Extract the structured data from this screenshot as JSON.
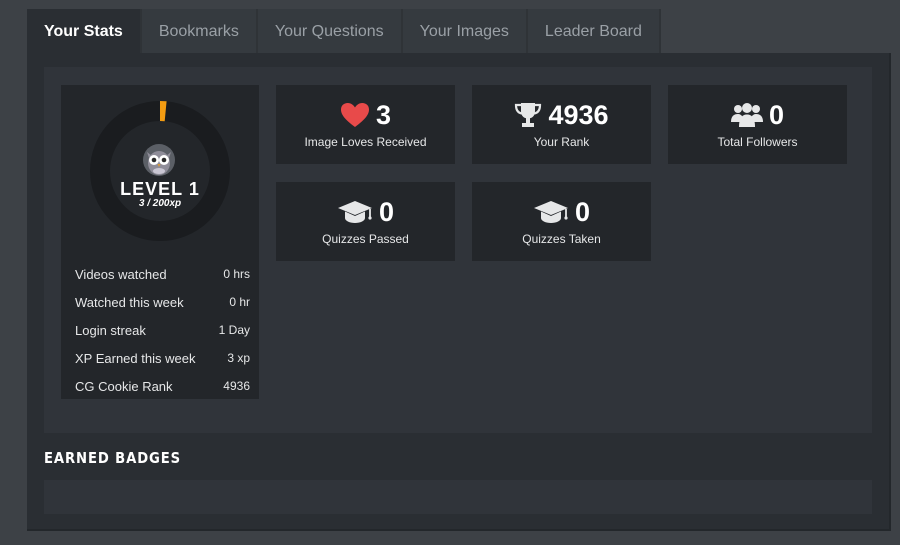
{
  "tabs": [
    {
      "label": "Your Stats",
      "active": true
    },
    {
      "label": "Bookmarks"
    },
    {
      "label": "Your Questions"
    },
    {
      "label": "Your Images"
    },
    {
      "label": "Leader Board"
    }
  ],
  "level": {
    "label": "LEVEL 1",
    "xp_text": "3 / 200xp",
    "progress_fraction": 0.015,
    "ring_color": "#f39c12",
    "avatar_icon": "owl-avatar-icon"
  },
  "stats": [
    {
      "name": "Videos watched",
      "value": "0 hrs"
    },
    {
      "name": "Watched this week",
      "value": "0 hr"
    },
    {
      "name": "Login streak",
      "value": "1 Day"
    },
    {
      "name": "XP Earned this week",
      "value": "3 xp"
    },
    {
      "name": "CG Cookie Rank",
      "value": "4936"
    }
  ],
  "cards": [
    {
      "value": "3",
      "label": "Image Loves Received",
      "icon": "heart-icon",
      "color": "#e84a4a"
    },
    {
      "value": "4936",
      "label": "Your Rank",
      "icon": "trophy-icon",
      "color": "#e6e7e8"
    },
    {
      "value": "0",
      "label": "Total Followers",
      "icon": "users-icon",
      "color": "#e6e7e8"
    },
    {
      "value": "0",
      "label": "Quizzes Passed",
      "icon": "graduation-cap-icon",
      "color": "#e6e7e8"
    },
    {
      "value": "0",
      "label": "Quizzes Taken",
      "icon": "graduation-cap-icon",
      "color": "#e6e7e8"
    }
  ],
  "badges": {
    "title": "EARNED BADGES"
  }
}
